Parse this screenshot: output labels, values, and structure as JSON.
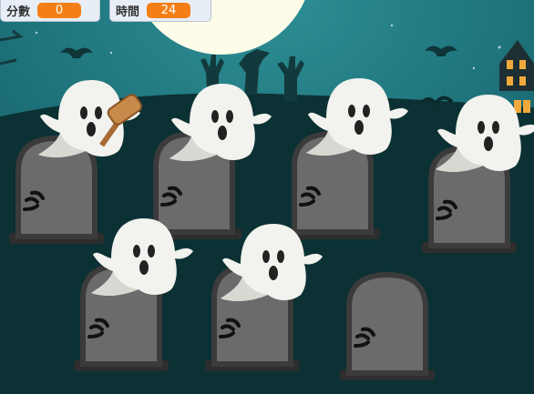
{
  "hud": {
    "score": {
      "label": "分數",
      "value": "0"
    },
    "time": {
      "label": "時間",
      "value": "24"
    }
  },
  "colors": {
    "sky": "#196a72",
    "ground": "#0b3134",
    "moon": "#fdfce8",
    "tombstone": "#6b6b6b",
    "tombstone_outline": "#3b3b3b",
    "ghost": "#f2f2ee",
    "hud_value_bg": "#f57f17",
    "hud_bg": "#e8eef6"
  },
  "icons": [
    "hammer-icon",
    "bat-icon",
    "haunted-house-icon",
    "zombie-hand-icon",
    "moon-icon"
  ]
}
